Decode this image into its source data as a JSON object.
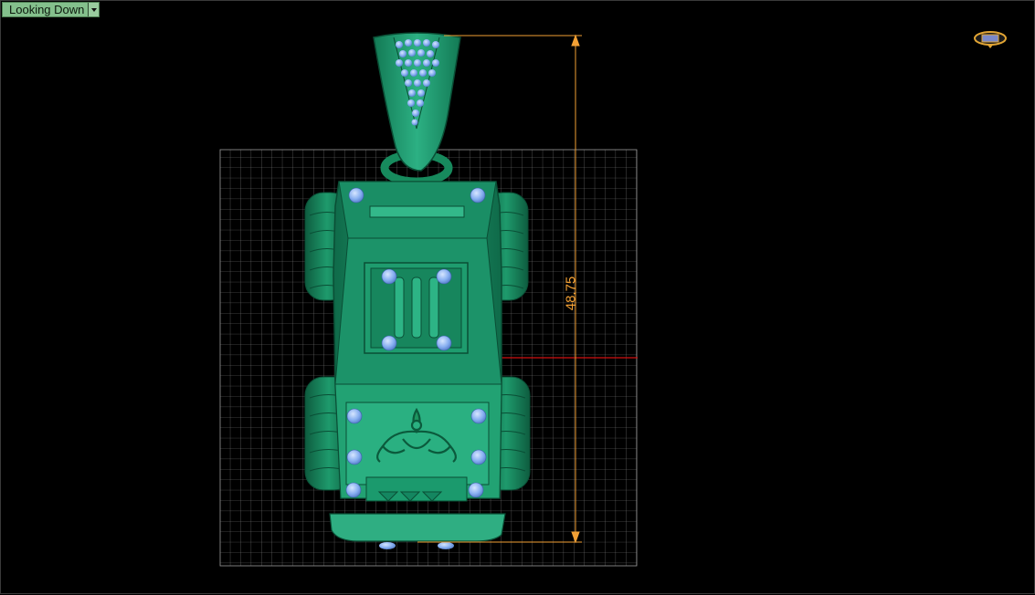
{
  "view_selector": {
    "label": "Looking Down"
  },
  "dimension": {
    "value": "48.75"
  },
  "icons": {
    "dropdown": "chevron-down-icon",
    "view_cube": "view-cube-icon"
  },
  "colors": {
    "background": "#000000",
    "model_green": "#1b8a63",
    "gem_blue": "#86aef0",
    "grid": "#8a8a8a",
    "dimension_line": "#f2a035",
    "axis_marker": "#d01010"
  }
}
